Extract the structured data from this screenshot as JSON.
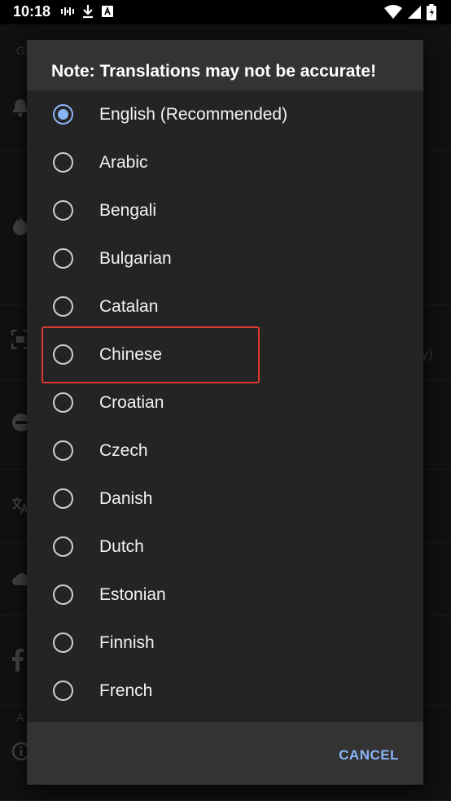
{
  "status_bar": {
    "time": "10:18",
    "left_icons": [
      "voicemail-icon",
      "download-icon",
      "a-badge-icon"
    ],
    "right_icons": [
      "wifi-icon",
      "signal-icon",
      "battery-icon"
    ]
  },
  "background": {
    "section_header_top": "G",
    "section_header_bottom": "A",
    "right_fragment": "y)"
  },
  "dialog": {
    "title": "Note: Translations may not be accurate!",
    "options": [
      {
        "label": "English (Recommended)",
        "checked": true
      },
      {
        "label": "Arabic",
        "checked": false
      },
      {
        "label": "Bengali",
        "checked": false
      },
      {
        "label": "Bulgarian",
        "checked": false
      },
      {
        "label": "Catalan",
        "checked": false
      },
      {
        "label": "Chinese",
        "checked": false
      },
      {
        "label": "Croatian",
        "checked": false
      },
      {
        "label": "Czech",
        "checked": false
      },
      {
        "label": "Danish",
        "checked": false
      },
      {
        "label": "Dutch",
        "checked": false
      },
      {
        "label": "Estonian",
        "checked": false
      },
      {
        "label": "Finnish",
        "checked": false
      },
      {
        "label": "French",
        "checked": false
      }
    ],
    "cancel_label": "CANCEL"
  },
  "colors": {
    "accent": "#8ab4f8",
    "highlight": "#d93a32",
    "dialog_bg": "#242424",
    "dialog_header_bg": "#333333"
  }
}
